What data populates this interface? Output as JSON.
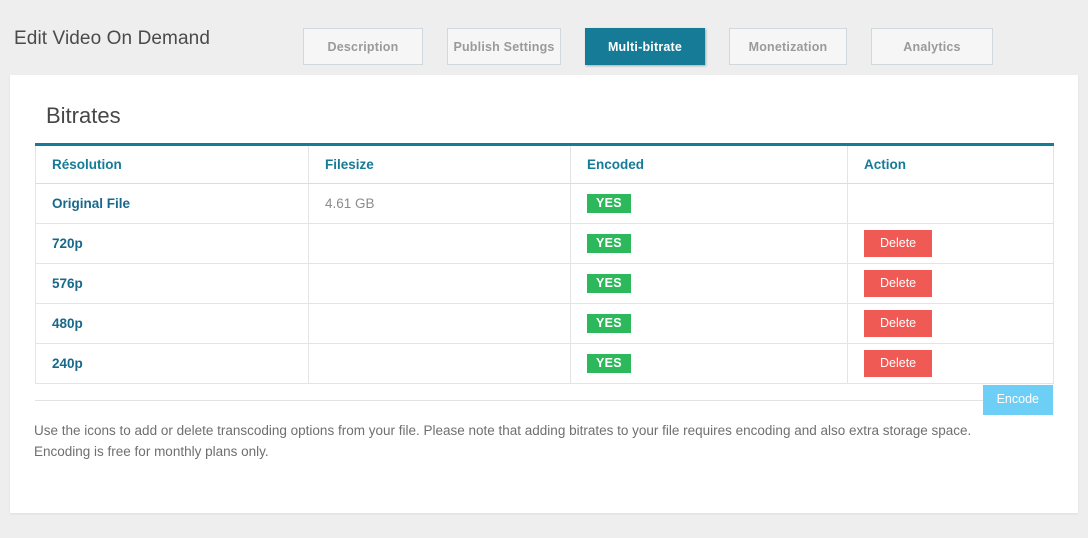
{
  "header": {
    "page_title": "Edit Video On Demand",
    "tabs": [
      {
        "label": "Description",
        "active": false
      },
      {
        "label": "Publish Settings",
        "active": false
      },
      {
        "label": "Multi-bitrate",
        "active": true
      },
      {
        "label": "Monetization",
        "active": false
      },
      {
        "label": "Analytics",
        "active": false
      }
    ]
  },
  "card": {
    "title": "Bitrates",
    "table": {
      "columns": [
        "Résolution",
        "Filesize",
        "Encoded",
        "Action"
      ],
      "rows": [
        {
          "resolution": "Original File",
          "filesize": "4.61 GB",
          "encoded": "YES",
          "action": ""
        },
        {
          "resolution": "720p",
          "filesize": "",
          "encoded": "YES",
          "action": "Delete"
        },
        {
          "resolution": "576p",
          "filesize": "",
          "encoded": "YES",
          "action": "Delete"
        },
        {
          "resolution": "480p",
          "filesize": "",
          "encoded": "YES",
          "action": "Delete"
        },
        {
          "resolution": "240p",
          "filesize": "",
          "encoded": "YES",
          "action": "Delete"
        }
      ]
    },
    "encode_button": "Encode",
    "footer_note": "Use the icons to add or delete transcoding options from your file. Please note that adding bitrates to your file requires encoding and also extra storage space. Encoding is free for monthly plans only."
  },
  "colors": {
    "accent_teal": "#157b97",
    "badge_green": "#2eb85c",
    "delete_red": "#ef5a54",
    "encode_blue": "#6dcff6",
    "page_background": "#eeeeee",
    "card_background": "#ffffff",
    "link_blue": "#17688a"
  }
}
